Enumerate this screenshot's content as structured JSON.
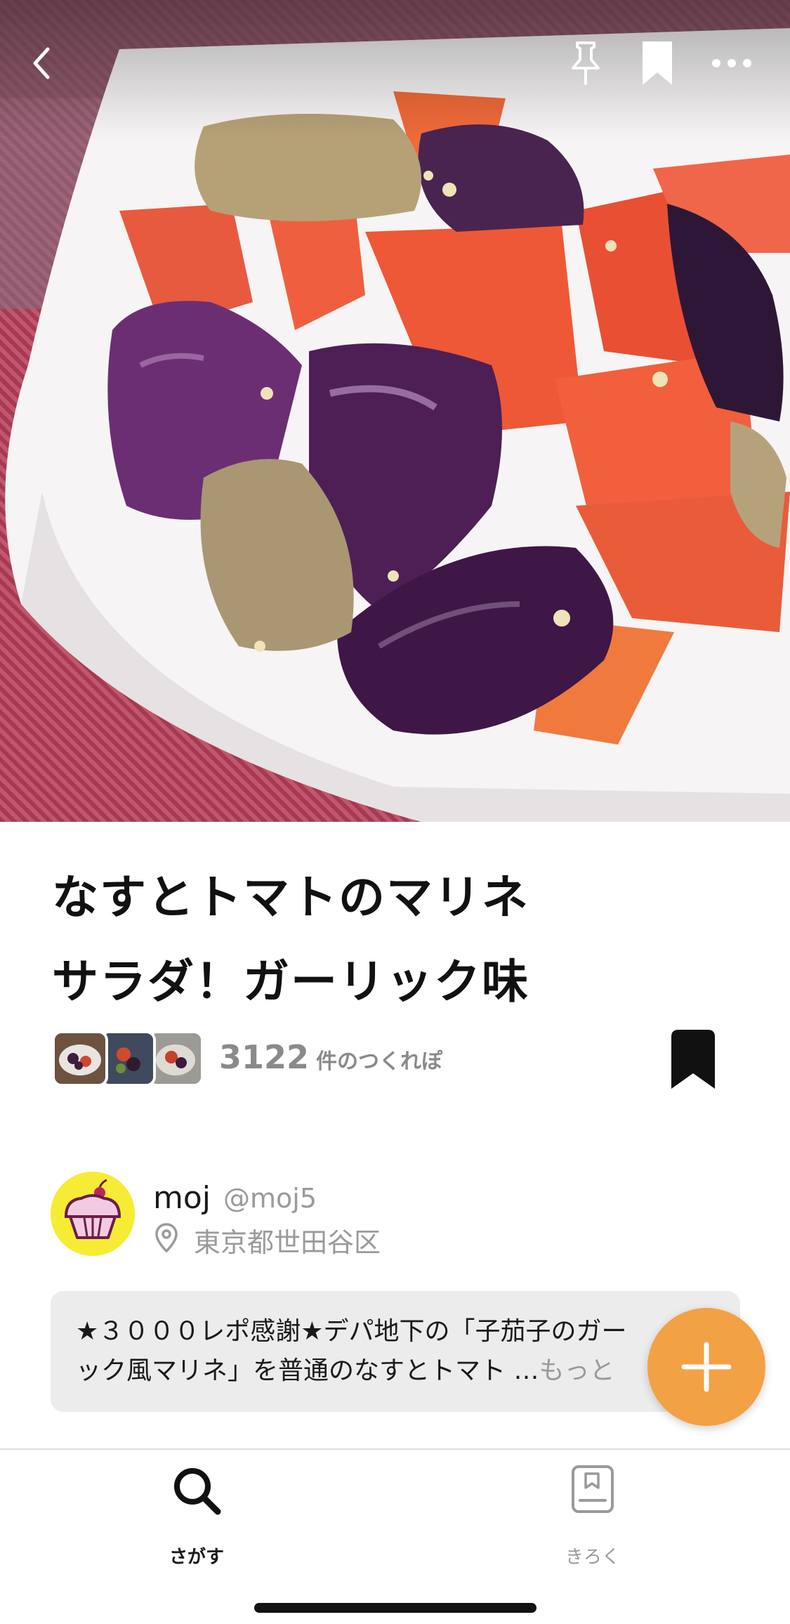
{
  "header": {
    "back_icon": "chevron-left-icon",
    "pin_icon": "pin-icon",
    "bookmark_icon": "bookmark-icon",
    "more_icon": "ellipsis-icon"
  },
  "recipe": {
    "title_lines": [
      "なすとトマトのマリネ",
      "サラダ！ガーリック味"
    ],
    "tsukurepo_count": "3122",
    "tsukurepo_unit": "件のつくれぽ"
  },
  "author": {
    "name": "moj",
    "handle": "@moj5",
    "location": "東京都世田谷区",
    "avatar_icon": "cupcake-icon"
  },
  "description": {
    "line1": "★３０００レポ感謝★デパ地下の「子茄子のガー",
    "line2": "ック風マリネ」を普通のなすとトマト …",
    "more_label": "もっと"
  },
  "tabs": [
    {
      "label": "さがす",
      "icon": "search-icon",
      "active": true
    },
    {
      "label": "きろく",
      "icon": "notebook-icon",
      "active": false
    }
  ],
  "colors": {
    "accent_orange": "#f2a145",
    "avatar_yellow": "#f6ec35",
    "muted_gray": "#9a9a9a",
    "description_bg": "#ececec"
  }
}
